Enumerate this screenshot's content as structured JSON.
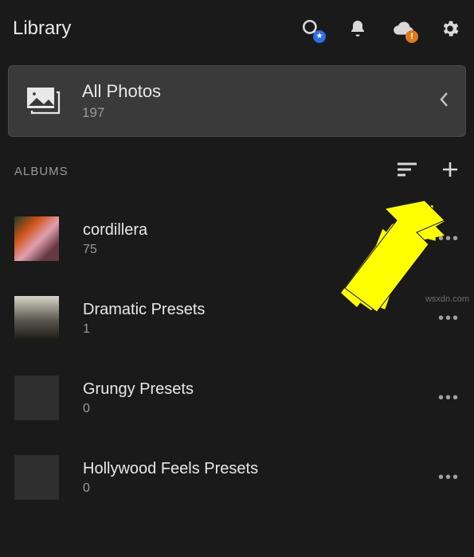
{
  "header": {
    "title": "Library"
  },
  "allPhotos": {
    "label": "All Photos",
    "count": "197"
  },
  "section": {
    "label": "ALBUMS"
  },
  "albums": [
    {
      "name": "cordillera",
      "count": "75"
    },
    {
      "name": "Dramatic Presets",
      "count": "1"
    },
    {
      "name": "Grungy Presets",
      "count": "0"
    },
    {
      "name": "Hollywood Feels Presets",
      "count": "0"
    }
  ],
  "colors": {
    "accentBlue": "#2d6fe0",
    "accentOrange": "#e07a1f",
    "annotationYellow": "#ffff00"
  },
  "watermark": "wsxdn.com"
}
